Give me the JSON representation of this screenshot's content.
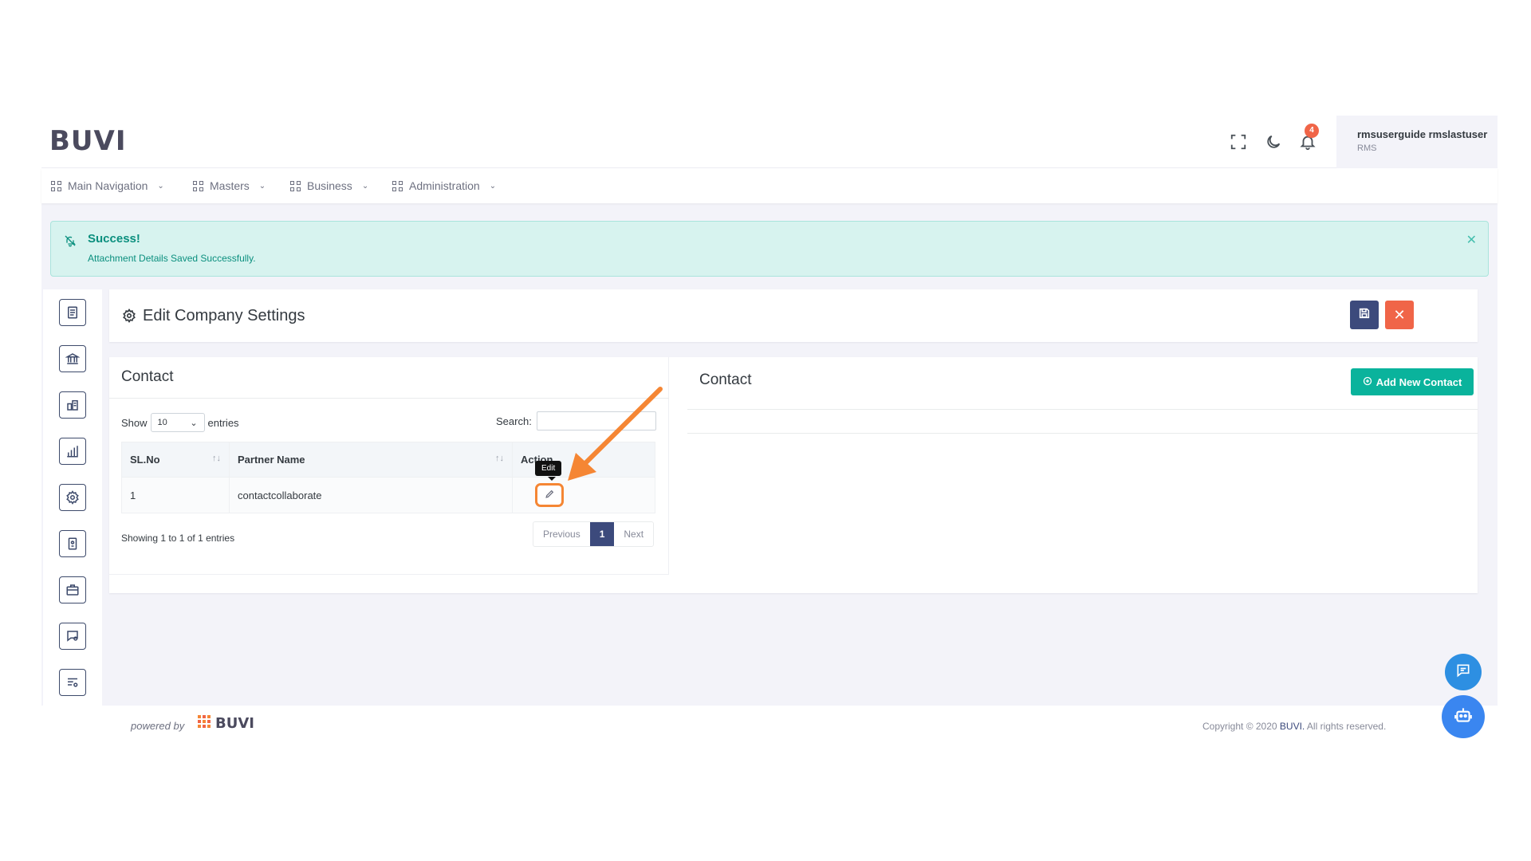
{
  "header": {
    "logo": "BUVI",
    "notification_count": "4",
    "user_name": "rmsuserguide rmslastuser",
    "user_role": "RMS",
    "icons": [
      "fullscreen-icon",
      "moon-icon",
      "bell-icon"
    ]
  },
  "nav": {
    "items": [
      {
        "label": "Main Navigation"
      },
      {
        "label": "Masters"
      },
      {
        "label": "Business"
      },
      {
        "label": "Administration"
      }
    ]
  },
  "alert": {
    "title": "Success!",
    "message": "Attachment Details Saved Successfully."
  },
  "sidebar": {
    "icons": [
      "document-icon",
      "bank-icon",
      "building-chart-icon",
      "bar-chart-icon",
      "settings-icon",
      "id-badge-icon",
      "briefcase-icon",
      "chat-settings-icon",
      "list-settings-icon"
    ]
  },
  "page": {
    "title": "Edit Company Settings"
  },
  "contact_table": {
    "title": "Contact",
    "show_label": "Show",
    "entries_value": "10",
    "entries_label": "entries",
    "search_label": "Search:",
    "columns": [
      "SL.No",
      "Partner Name",
      "Action"
    ],
    "rows": [
      {
        "sl": "1",
        "partner": "contactcollaborate"
      }
    ],
    "tooltip": "Edit",
    "showing_text": "Showing 1 to 1 of 1 entries",
    "pagination": {
      "previous": "Previous",
      "current": "1",
      "next": "Next"
    }
  },
  "contact_panel": {
    "title": "Contact",
    "add_button": "Add New Contact"
  },
  "footer": {
    "powered_by": "powered by",
    "logo": "BUVI",
    "copyright_prefix": "Copyright © 2020",
    "copyright_brand": "BUVI.",
    "copyright_suffix": "All rights reserved."
  },
  "colors": {
    "primary": "#3c4a7c",
    "danger": "#f06548",
    "success": "#0ab39c",
    "highlight": "#f58634"
  }
}
